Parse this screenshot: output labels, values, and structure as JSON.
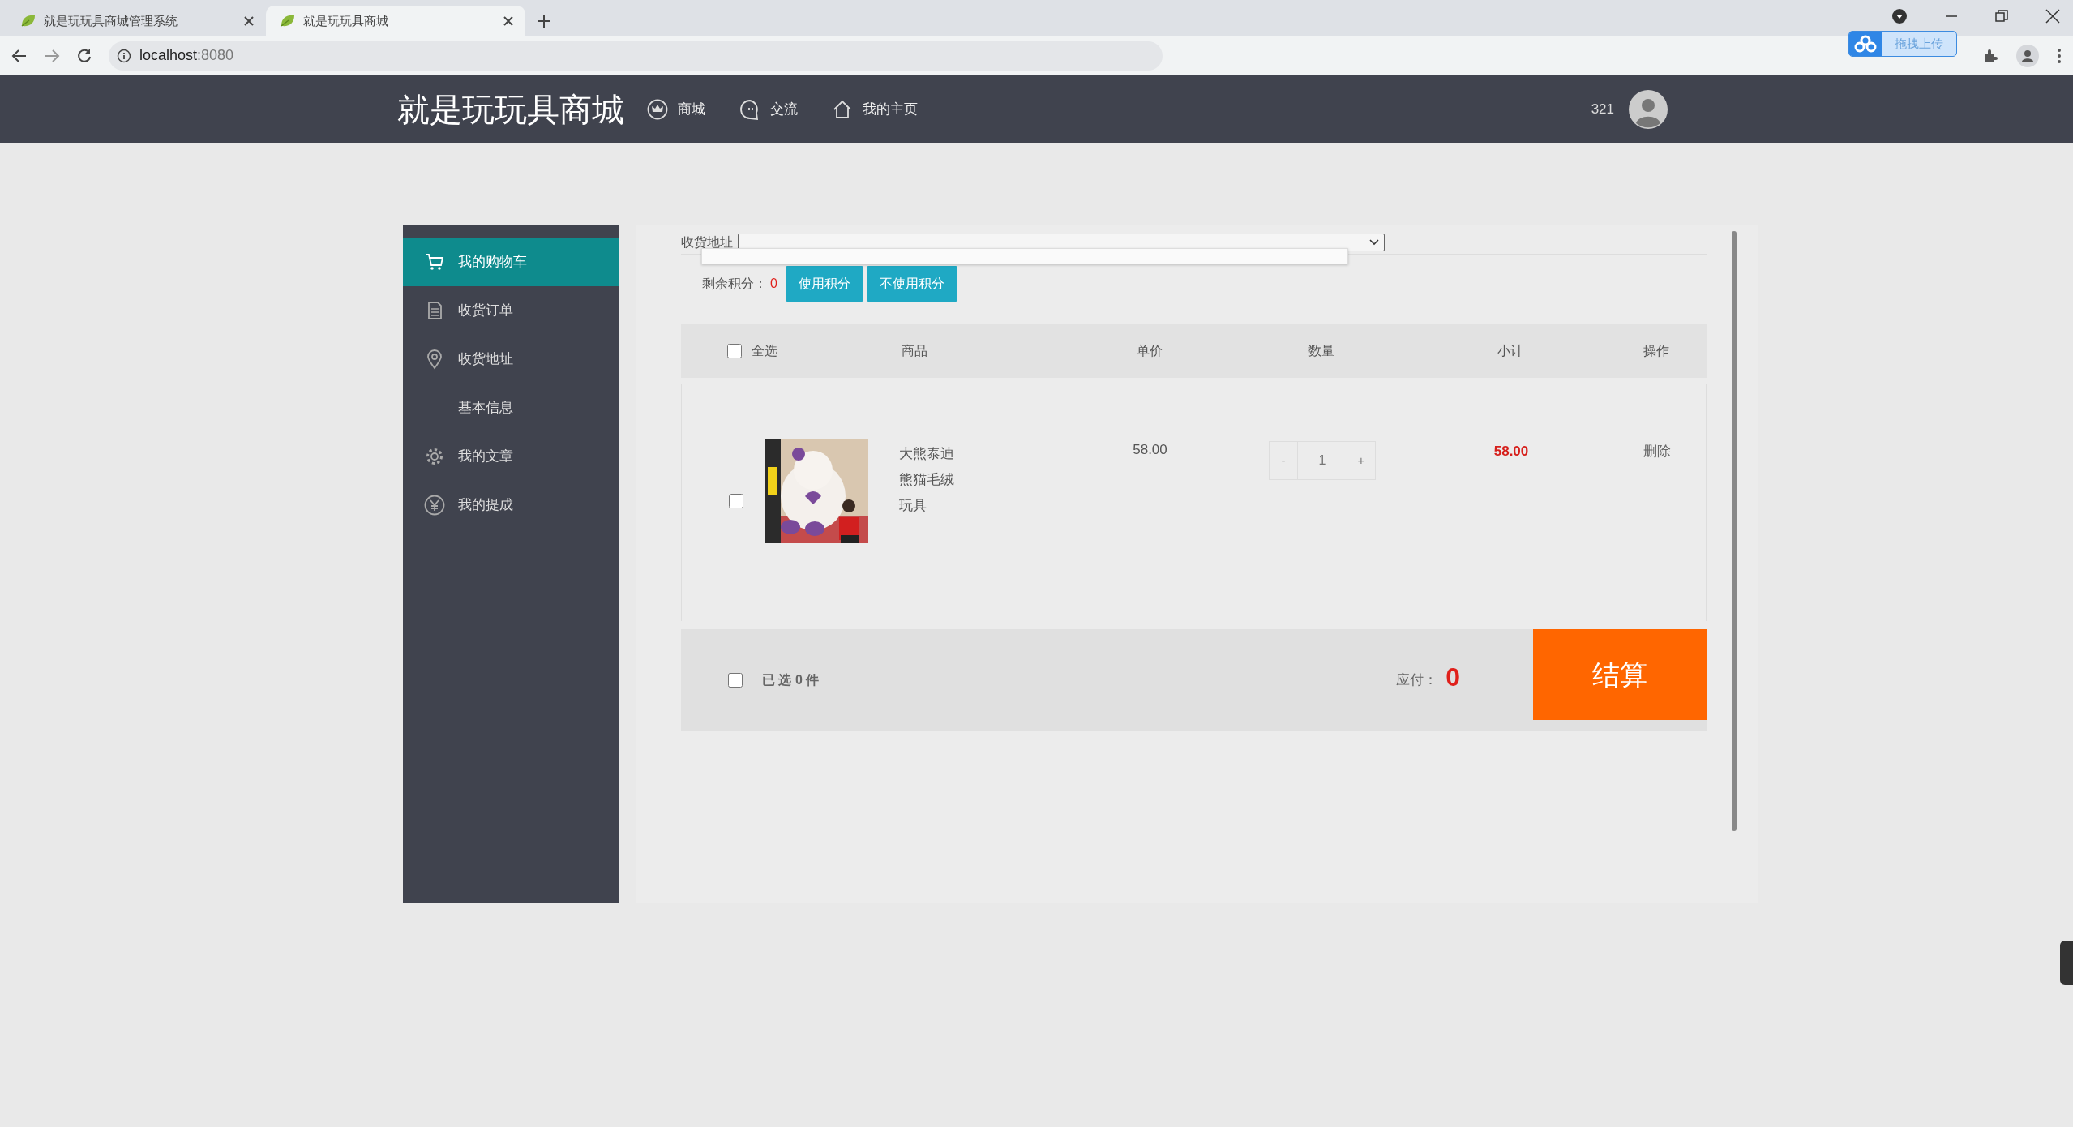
{
  "browser": {
    "tabs": [
      {
        "title": "就是玩玩具商城管理系统",
        "selected": false
      },
      {
        "title": "就是玩玩具商城",
        "selected": true
      }
    ],
    "url_host": "localhost",
    "url_port": ":8080",
    "upload_widget": "拖拽上传"
  },
  "header": {
    "logo": "就是玩玩具商城",
    "nav": [
      {
        "label": "商城",
        "kind": "crown"
      },
      {
        "label": "交流",
        "kind": "chat"
      },
      {
        "label": "我的主页",
        "kind": "home"
      }
    ],
    "username": "321"
  },
  "sidebar": {
    "items": [
      {
        "label": "我的购物车",
        "kind": "cart",
        "selected": true
      },
      {
        "label": "收货订单",
        "kind": "doc",
        "selected": false
      },
      {
        "label": "收货地址",
        "kind": "pin",
        "selected": false
      },
      {
        "label": "基本信息",
        "kind": "plain",
        "selected": false
      },
      {
        "label": "我的文章",
        "kind": "gear",
        "selected": false
      },
      {
        "label": "我的提成",
        "kind": "yen",
        "selected": false
      }
    ]
  },
  "address": {
    "label": "收货地址"
  },
  "points": {
    "label": "剩余积分：",
    "value": "0",
    "buttons": [
      "使用积分",
      "不使用积分"
    ]
  },
  "cart": {
    "select_all_label": "全选",
    "select_all_checked": false,
    "columns": [
      "商品",
      "单价",
      "数量",
      "小计",
      "操作"
    ],
    "items": [
      {
        "checked": false,
        "name": "大熊泰迪熊猫毛绒玩具",
        "price": "58.00",
        "minus": "-",
        "quantity": "1",
        "plus": "+",
        "subtotal": "58.00",
        "action": "删除"
      }
    ]
  },
  "footer": {
    "checked": false,
    "selected_text": "已 选 0 件",
    "payable_label": "应付：",
    "payable": "0",
    "checkout": "结算"
  }
}
